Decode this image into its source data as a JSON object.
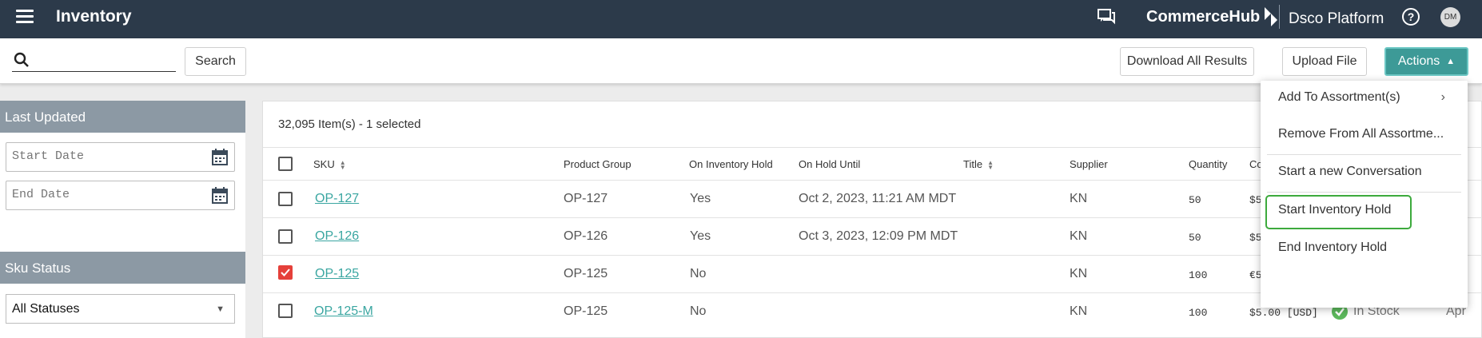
{
  "app": {
    "title": "Inventory",
    "brand": "CommerceHub",
    "platform": "Dsco Platform",
    "help_glyph": "?",
    "avatar_initials": "DM"
  },
  "toolbar": {
    "search_placeholder": "",
    "search_label": "Search",
    "download_label": "Download All Results",
    "upload_label": "Upload File",
    "actions_label": "Actions"
  },
  "filters": {
    "last_updated_label": "Last Updated",
    "start_date_placeholder": "Start Date",
    "end_date_placeholder": "End Date",
    "sku_status_label": "Sku Status",
    "sku_status_value": "All Statuses"
  },
  "table": {
    "count_text": "32,095 Item(s) - 1 selected",
    "headers": {
      "sku": "SKU",
      "product_group": "Product Group",
      "on_inventory_hold": "On Inventory Hold",
      "on_hold_until": "On Hold Until",
      "title": "Title",
      "supplier": "Supplier",
      "quantity": "Quantity",
      "cost": "Co"
    },
    "rows": [
      {
        "sku": "OP-127",
        "product_group": "OP-127",
        "on_hold": "Yes",
        "hold_until": "Oct 2, 2023, 11:21 AM MDT",
        "supplier": "KN",
        "quantity": "50",
        "cost": "$5",
        "checked": false
      },
      {
        "sku": "OP-126",
        "product_group": "OP-126",
        "on_hold": "Yes",
        "hold_until": "Oct 3, 2023, 12:09 PM MDT",
        "supplier": "KN",
        "quantity": "50",
        "cost": "$5",
        "checked": false
      },
      {
        "sku": "OP-125",
        "product_group": "OP-125",
        "on_hold": "No",
        "hold_until": "",
        "supplier": "KN",
        "quantity": "100",
        "cost": "€5",
        "checked": true
      },
      {
        "sku": "OP-125-M",
        "product_group": "OP-125",
        "on_hold": "No",
        "hold_until": "",
        "supplier": "KN",
        "quantity": "100",
        "cost": "$5.00 [USD]",
        "status": "In Stock",
        "date_partial": "Apr",
        "checked": false
      }
    ]
  },
  "actions_menu": {
    "items": [
      {
        "label": "Add To Assortment(s)",
        "has_submenu": true
      },
      {
        "label": "Remove From All Assortme..."
      },
      {
        "label": "Start a new Conversation"
      },
      {
        "label": "Start Inventory Hold",
        "highlighted": true
      },
      {
        "label": "End Inventory Hold"
      }
    ]
  },
  "colors": {
    "topbar": "#2c3a4a",
    "accent_teal": "#3d9a97",
    "link": "#3aa6a1",
    "checkbox_checked": "#e5403a",
    "highlight_border": "#3daa3d",
    "panel_header": "#8c99a4"
  }
}
